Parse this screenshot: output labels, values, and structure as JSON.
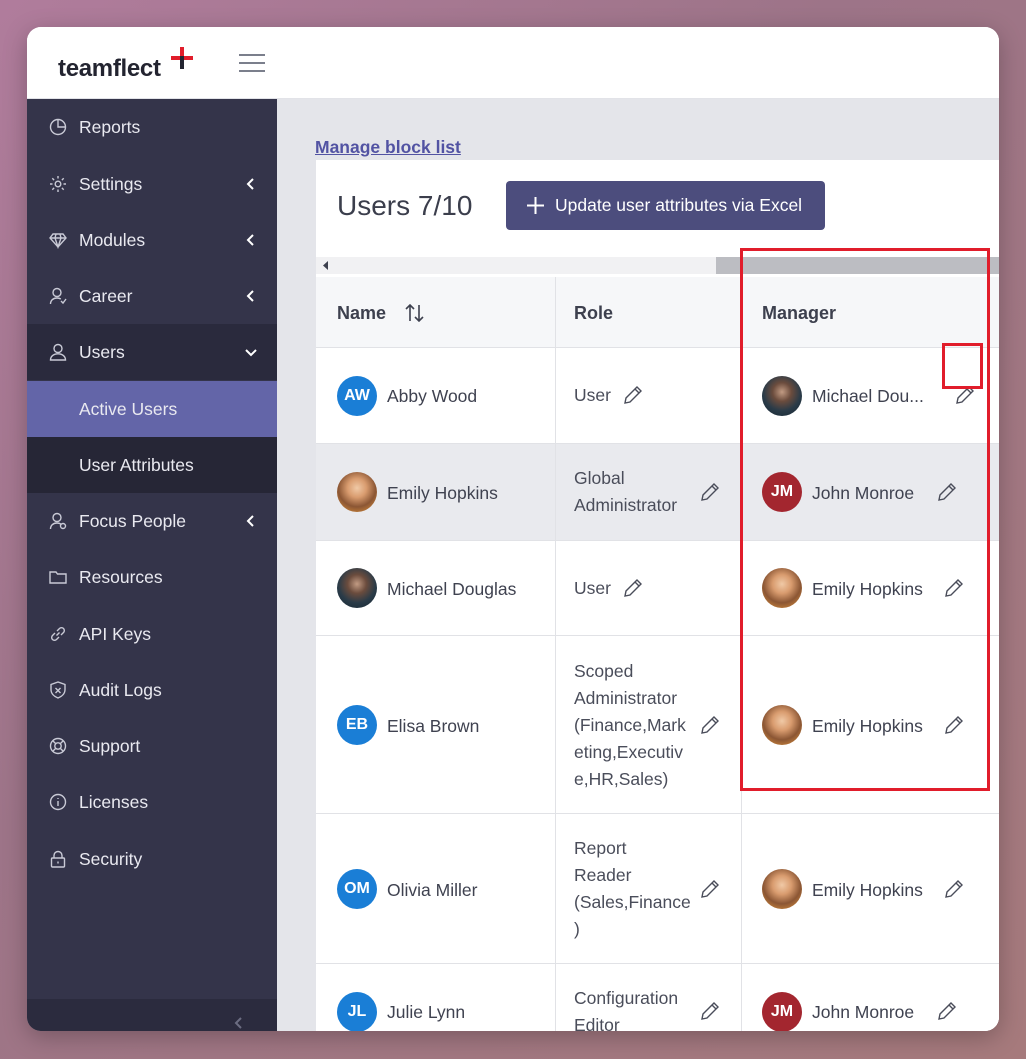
{
  "app": {
    "logo_text": "teamflect",
    "accent": "#e11d2b",
    "sidebar_bg": "#34344a",
    "active_bg": "#6365a8"
  },
  "sidebar": {
    "items": [
      {
        "label": "Reports",
        "icon": "reports-icon",
        "chevron": false
      },
      {
        "label": "Settings",
        "icon": "gear-icon",
        "chevron": "left"
      },
      {
        "label": "Modules",
        "icon": "diamond-icon",
        "chevron": "left"
      },
      {
        "label": "Career",
        "icon": "career-icon",
        "chevron": "left"
      },
      {
        "label": "Users",
        "icon": "user-icon",
        "chevron": "down"
      },
      {
        "label": "Active Users",
        "sub": true,
        "active": true
      },
      {
        "label": "User Attributes",
        "sub": true
      },
      {
        "label": "Focus People",
        "icon": "focus-people-icon",
        "chevron": "left"
      },
      {
        "label": "Resources",
        "icon": "folder-icon",
        "chevron": false
      },
      {
        "label": "API Keys",
        "icon": "link-icon",
        "chevron": false
      },
      {
        "label": "Audit Logs",
        "icon": "shield-icon",
        "chevron": false
      },
      {
        "label": "Support",
        "icon": "lifebuoy-icon",
        "chevron": false
      },
      {
        "label": "Licenses",
        "icon": "info-icon",
        "chevron": false
      },
      {
        "label": "Security",
        "icon": "lock-icon",
        "chevron": false
      }
    ]
  },
  "main": {
    "block_link": "Manage block list",
    "title": "Users 7/10",
    "update_button": "Update user attributes via Excel",
    "columns": {
      "name": "Name",
      "role": "Role",
      "manager": "Manager"
    }
  },
  "rows": [
    {
      "initials": "AW",
      "name": "Abby Wood",
      "role": [
        "User"
      ],
      "manager": "Michael Dou...",
      "manager_avatar": "photo-michael"
    },
    {
      "avatar": "photo-emily",
      "name": "Emily Hopkins",
      "role": [
        "Global",
        "Administrator"
      ],
      "manager": "John Monroe",
      "manager_initials": "JM"
    },
    {
      "avatar": "photo-michael",
      "name": "Michael Douglas",
      "role": [
        "User"
      ],
      "manager": "Emily Hopkins",
      "manager_avatar": "photo-emily"
    },
    {
      "initials": "EB",
      "name": "Elisa Brown",
      "role": [
        "Scoped",
        "Administrator",
        "(Finance,Mark",
        "eting,Executiv",
        "e,HR,Sales)"
      ],
      "manager": "Emily Hopkins",
      "manager_avatar": "photo-emily"
    },
    {
      "initials": "OM",
      "name": "Olivia Miller",
      "role": [
        "Report",
        "Reader",
        "(Sales,Finance",
        ")"
      ],
      "manager": "Emily Hopkins",
      "manager_avatar": "photo-emily"
    },
    {
      "initials": "JL",
      "name": "Julie Lynn",
      "role": [
        "Configuration",
        "Editor"
      ],
      "manager": "John Monroe",
      "manager_initials": "JM"
    }
  ]
}
